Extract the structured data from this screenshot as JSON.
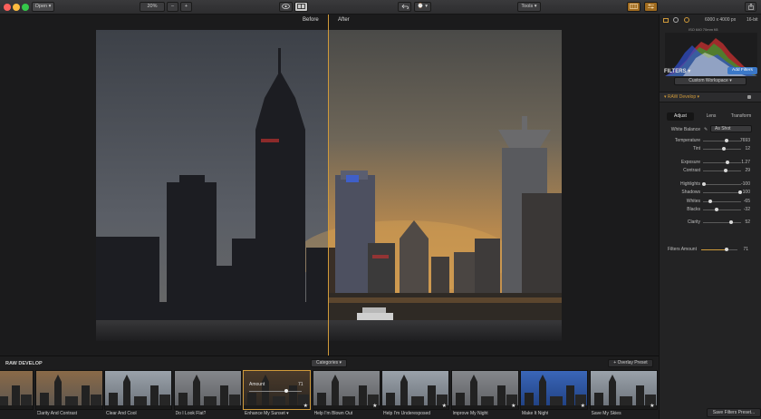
{
  "toolbar": {
    "open_label": "Open ▾",
    "zoom_value": "20%",
    "zoom_minus": "–",
    "zoom_plus": "+",
    "tools_label": "Tools ▾",
    "history_label": "⌚ ▾"
  },
  "compare": {
    "before": "Before",
    "after": "After"
  },
  "info": {
    "dimensions": "6000 x 4000 px",
    "bitdepth": "16-bit",
    "histo_meta": "ISO 640   70mm   f/8"
  },
  "filters": {
    "title": "FILTERS ▾",
    "add_button": "Add Filters",
    "workspace": "Custom Workspace ▾",
    "raw_develop": "▾ RAW Develop ▾",
    "tabs": [
      "Adjust",
      "Lens",
      "Transform"
    ],
    "white_balance": {
      "label": "White Balance",
      "value": "As Shot"
    },
    "adjustments": [
      {
        "label": "Temperature",
        "value": "7693",
        "pos": 0.62
      },
      {
        "label": "Tint",
        "value": "12",
        "pos": 0.55
      },
      {
        "label": "Exposure",
        "value": "1.27",
        "pos": 0.64
      },
      {
        "label": "Contrast",
        "value": "29",
        "pos": 0.6
      },
      {
        "label": "Highlights",
        "value": "-100",
        "pos": 0.0
      },
      {
        "label": "Shadows",
        "value": "100",
        "pos": 1.0
      },
      {
        "label": "Whites",
        "value": "-65",
        "pos": 0.18
      },
      {
        "label": "Blacks",
        "value": "-32",
        "pos": 0.34
      },
      {
        "label": "Clarity",
        "value": "52",
        "pos": 0.76
      }
    ],
    "filters_amount": {
      "label": "Filters Amount",
      "value": "71",
      "pos": 0.71
    },
    "save_button": "Save Filters Preset..."
  },
  "presets": {
    "section_label": "RAW DEVELOP",
    "categories": "Categories ▾",
    "overlay": "+ Overlay Preset",
    "amount_label": "Amount",
    "amount_value": "71",
    "amount_pos": 0.71,
    "items": [
      {
        "label": "he Light",
        "tone": "warm"
      },
      {
        "label": "Clarity And Contrast",
        "tone": "warm"
      },
      {
        "label": "Clear And Cool",
        "tone": "cool"
      },
      {
        "label": "Do I Look Flat?",
        "tone": "grey"
      },
      {
        "label": "Enhance My Sunset ▾",
        "tone": "dark"
      },
      {
        "label": "Help I'm Blown Out",
        "tone": "grey"
      },
      {
        "label": "Help I'm Underexposed",
        "tone": "cool"
      },
      {
        "label": "Improve My Night",
        "tone": "grey"
      },
      {
        "label": "Make It Night",
        "tone": "blue"
      },
      {
        "label": "Save My Skies",
        "tone": "cool"
      }
    ]
  },
  "colors": {
    "accent": "#d09a3a",
    "button_blue": "#3b78c8"
  }
}
